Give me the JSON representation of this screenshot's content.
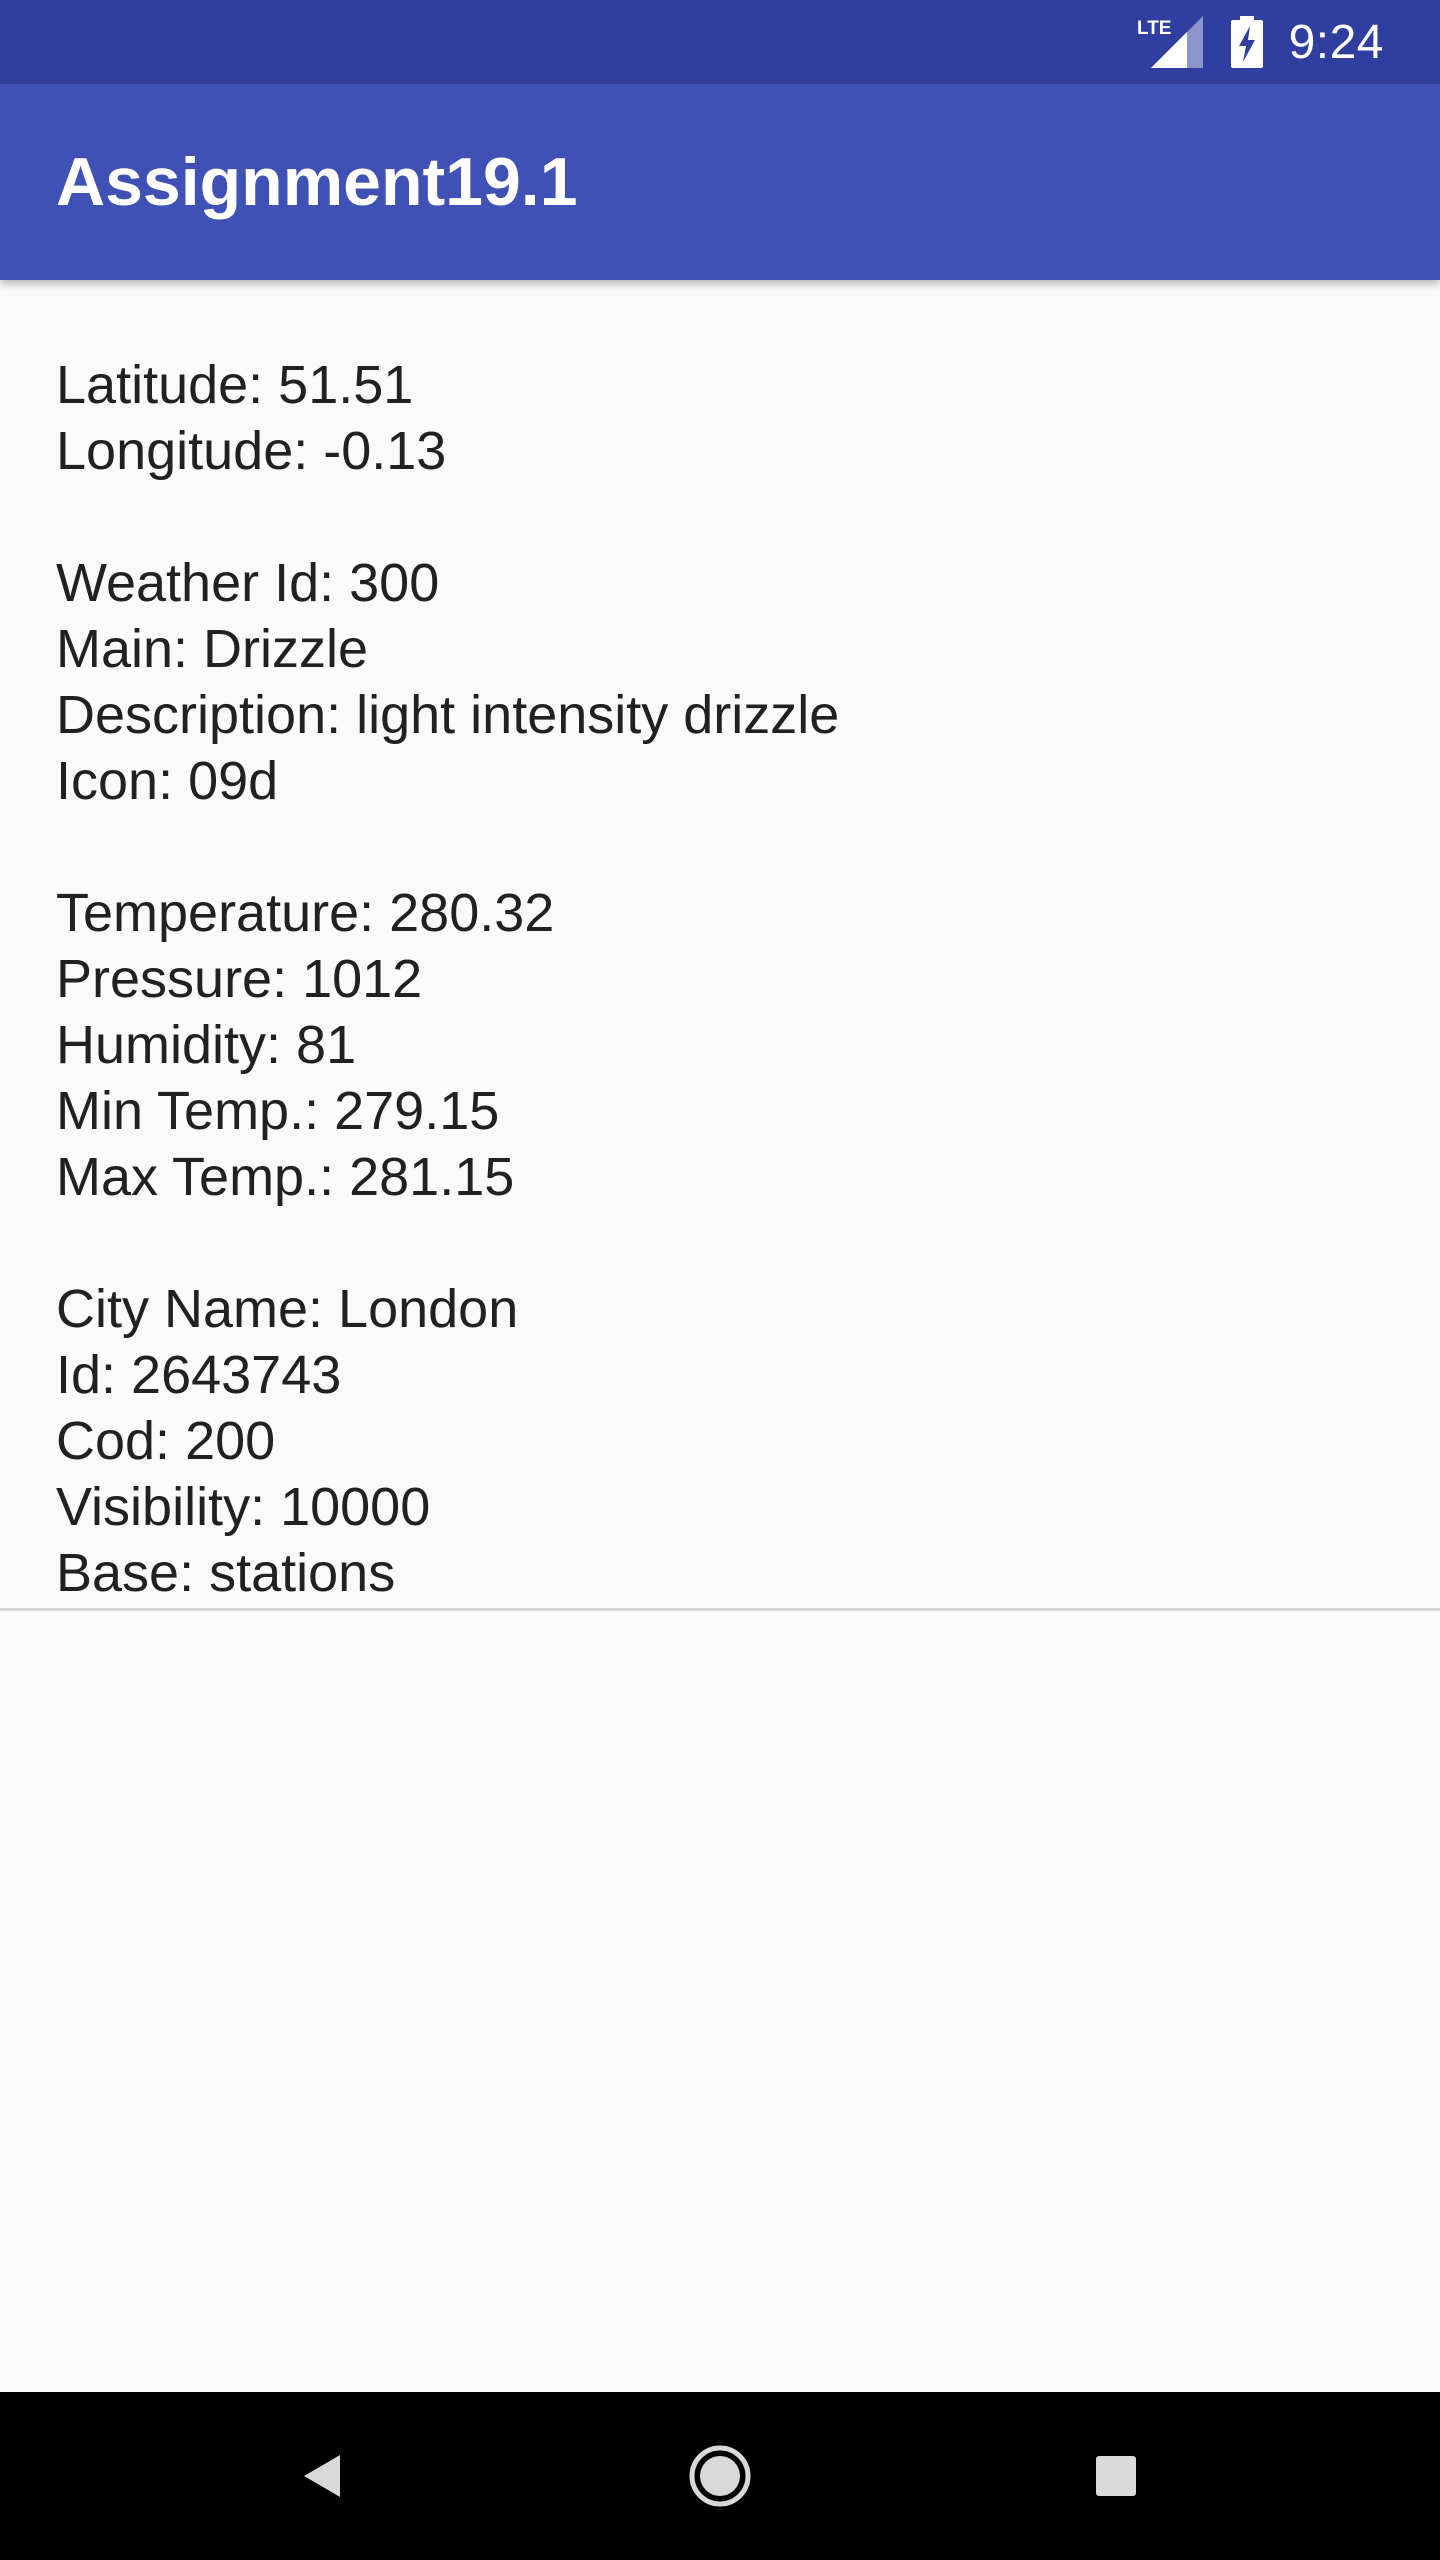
{
  "status_bar": {
    "network_label": "LTE",
    "time": "9:24",
    "icons": [
      "lte-signal-icon",
      "battery-charging-icon"
    ]
  },
  "app_bar": {
    "title": "Assignment19.1",
    "color": "#3f51b5",
    "status_color": "#303f9f"
  },
  "weather": {
    "latitude": "Latitude: 51.51",
    "longitude": "Longitude: -0.13",
    "weather_id": "Weather Id: 300",
    "main": "Main: Drizzle",
    "description": "Description: light intensity drizzle",
    "icon": "Icon: 09d",
    "temperature": "Temperature: 280.32",
    "pressure": "Pressure: 1012",
    "humidity": "Humidity: 81",
    "min_temp": "Min Temp.: 279.15",
    "max_temp": "Max Temp.: 281.15",
    "city_name": "City Name: London",
    "id": "Id: 2643743",
    "cod": "Cod: 200",
    "visibility": "Visibility: 10000",
    "base": "Base: stations"
  },
  "nav_bar": {
    "icons": [
      "back-icon",
      "home-icon",
      "recents-icon"
    ]
  }
}
